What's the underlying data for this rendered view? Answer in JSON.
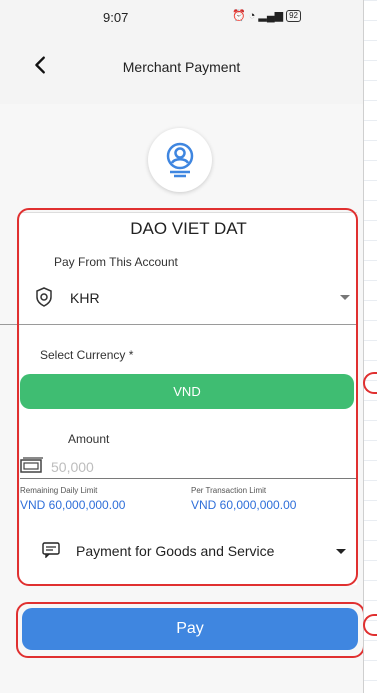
{
  "status_bar": {
    "time": "9:07",
    "battery": "92"
  },
  "header": {
    "title": "Merchant Payment"
  },
  "payee": {
    "name": "DAO VIET DAT"
  },
  "account": {
    "label": "Pay From This Account",
    "value": "KHR"
  },
  "currency": {
    "label": "Select Currency *",
    "selected": "VND"
  },
  "amount": {
    "label": "Amount",
    "placeholder": "50,000",
    "value": ""
  },
  "limits": {
    "daily_label": "Remaining Daily Limit",
    "daily_value": "VND 60,000,000.00",
    "per_txn_label": "Per Transaction Limit",
    "per_txn_value": "VND 60,000,000.00"
  },
  "purpose": {
    "selected": "Payment for Goods and Service"
  },
  "pay_button": {
    "label": "Pay"
  },
  "colors": {
    "currency_button": "#3fbd72",
    "pay_button": "#3f86e0",
    "highlight": "#e03030",
    "limit_text": "#2f6fd9"
  },
  "icons": [
    "back-arrow-icon",
    "alarm-icon",
    "wifi-icon",
    "signal-icon",
    "battery-icon",
    "merchant-avatar-icon",
    "shield-icon",
    "chevron-down-icon",
    "cash-icon",
    "message-icon"
  ]
}
